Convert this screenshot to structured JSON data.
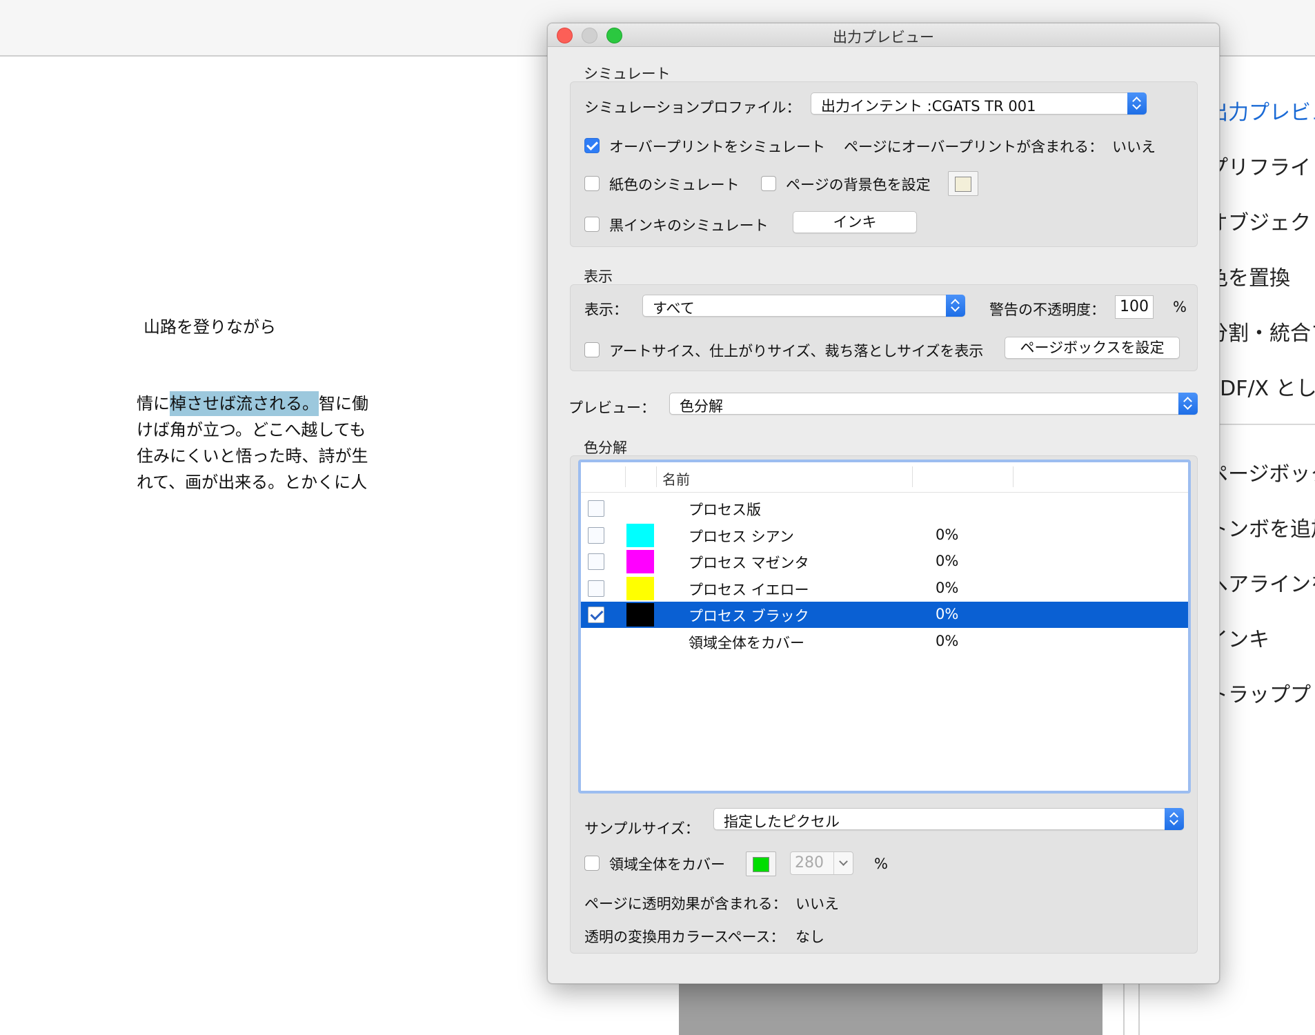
{
  "document": {
    "heading": "山路を登りながら",
    "para_lines": [
      {
        "before": "情に",
        "highlight": "棹させば流される。",
        "after": "智に働"
      },
      {
        "before": "けば角が立つ。どこへ越しても",
        "highlight": "",
        "after": ""
      },
      {
        "before": "住みにくいと悟った時、詩が生",
        "highlight": "",
        "after": ""
      },
      {
        "before": "れて、画が出来る。とかくに人",
        "highlight": "",
        "after": ""
      }
    ]
  },
  "right_panel": {
    "items": [
      "出力プレビュー",
      "プリフライト",
      "オブジェクト",
      "色を置換",
      "分割・統合プ",
      "PDF/X として",
      "ページボック",
      "トンボを追加",
      "ヘアラインを",
      "インキ",
      "トラッププリ"
    ]
  },
  "dialog": {
    "title": "出力プレビュー",
    "simulate": {
      "section_label": "シミュレート",
      "profile_label": "シミュレーションプロファイル：",
      "profile_value": "出力インテント :CGATS TR 001",
      "overprint_label": "オーバープリントをシミュレート",
      "overprint_checked": true,
      "page_has_overprint_label": "ページにオーバープリントが含まれる：",
      "page_has_overprint_value": "いいえ",
      "paper_color_label": "紙色のシミュレート",
      "page_bg_label": "ページの背景色を設定",
      "page_bg_color": "#f3efd9",
      "black_ink_label": "黒インキのシミュレート",
      "ink_button": "インキ"
    },
    "display": {
      "section_label": "表示",
      "show_label": "表示：",
      "show_value": "すべて",
      "warning_opacity_label": "警告の不透明度：",
      "warning_opacity_value": "100",
      "percent": "%",
      "boxes_label": "アートサイス、仕上がりサイズ、裁ち落としサイズを表示",
      "page_box_button": "ページボックスを設定"
    },
    "preview": {
      "label": "プレビュー：",
      "value": "色分解"
    },
    "separations": {
      "section_label": "色分解",
      "name_header": "名前",
      "rows": [
        {
          "name": "プロセス版",
          "pct": "",
          "color": "",
          "checked": false,
          "selected": false,
          "has_checkbox": true
        },
        {
          "name": "プロセス シアン",
          "pct": "0%",
          "color": "#00ffff",
          "checked": false,
          "selected": false,
          "has_checkbox": true
        },
        {
          "name": "プロセス マゼンタ",
          "pct": "0%",
          "color": "#ff00ff",
          "checked": false,
          "selected": false,
          "has_checkbox": true
        },
        {
          "name": "プロセス イエロー",
          "pct": "0%",
          "color": "#ffff00",
          "checked": false,
          "selected": false,
          "has_checkbox": true
        },
        {
          "name": "プロセス ブラック",
          "pct": "0%",
          "color": "#000000",
          "checked": true,
          "selected": true,
          "has_checkbox": true
        },
        {
          "name": "領域全体をカバー",
          "pct": "0%",
          "color": "",
          "checked": false,
          "selected": false,
          "has_checkbox": false
        }
      ],
      "sample_size_label": "サンプルサイズ：",
      "sample_size_value": "指定したピクセル",
      "coverage_label": "領域全体をカバー",
      "coverage_color": "#00dd00",
      "coverage_value": "280",
      "coverage_percent": "%",
      "transparency_label": "ページに透明効果が含まれる：",
      "transparency_value": "いいえ",
      "blend_space_label": "透明の変換用カラースペース：",
      "blend_space_value": "なし"
    }
  }
}
